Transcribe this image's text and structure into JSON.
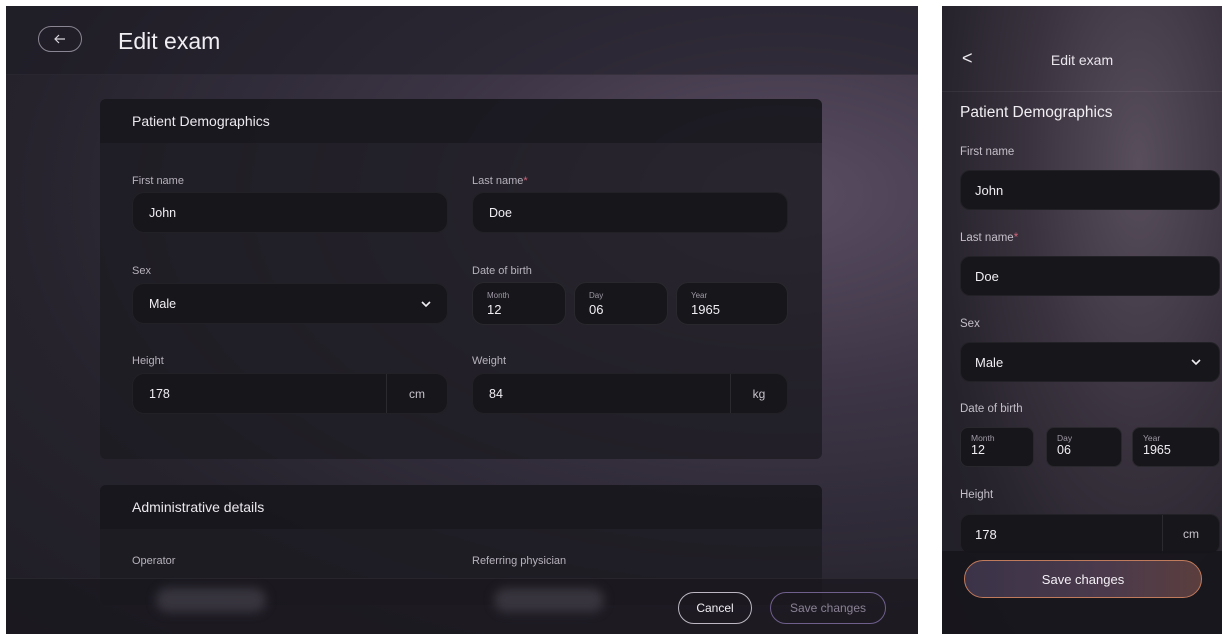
{
  "desktop": {
    "title": "Edit exam",
    "back_icon": "arrow-left-icon",
    "patient_section": {
      "title": "Patient Demographics",
      "first_name": {
        "label": "First name",
        "value": "John"
      },
      "last_name": {
        "label": "Last name",
        "required": "*",
        "value": "Doe"
      },
      "sex": {
        "label": "Sex",
        "value": "Male"
      },
      "dob": {
        "label": "Date of birth",
        "month_caption": "Month",
        "month": "12",
        "day_caption": "Day",
        "day": "06",
        "year_caption": "Year",
        "year": "1965"
      },
      "height": {
        "label": "Height",
        "value": "178",
        "unit": "cm"
      },
      "weight": {
        "label": "Weight",
        "value": "84",
        "unit": "kg"
      }
    },
    "admin_section": {
      "title": "Administrative details",
      "operator_label": "Operator",
      "referring_label": "Referring physician"
    },
    "footer": {
      "cancel": "Cancel",
      "save": "Save changes"
    }
  },
  "mobile": {
    "title": "Edit exam",
    "back_glyph": "<",
    "section_title": "Patient Demographics",
    "first_name": {
      "label": "First name",
      "value": "John"
    },
    "last_name": {
      "label": "Last name",
      "required": "*",
      "value": "Doe"
    },
    "sex": {
      "label": "Sex",
      "value": "Male"
    },
    "dob": {
      "label": "Date of birth",
      "month_caption": "Month",
      "month": "12",
      "day_caption": "Day",
      "day": "06",
      "year_caption": "Year",
      "year": "1965"
    },
    "height": {
      "label": "Height",
      "value": "178",
      "unit": "cm"
    },
    "save": "Save changes"
  },
  "colors": {
    "accent_border": "#c07a5c",
    "required": "#d1657a",
    "input_bg": "#17161b"
  }
}
